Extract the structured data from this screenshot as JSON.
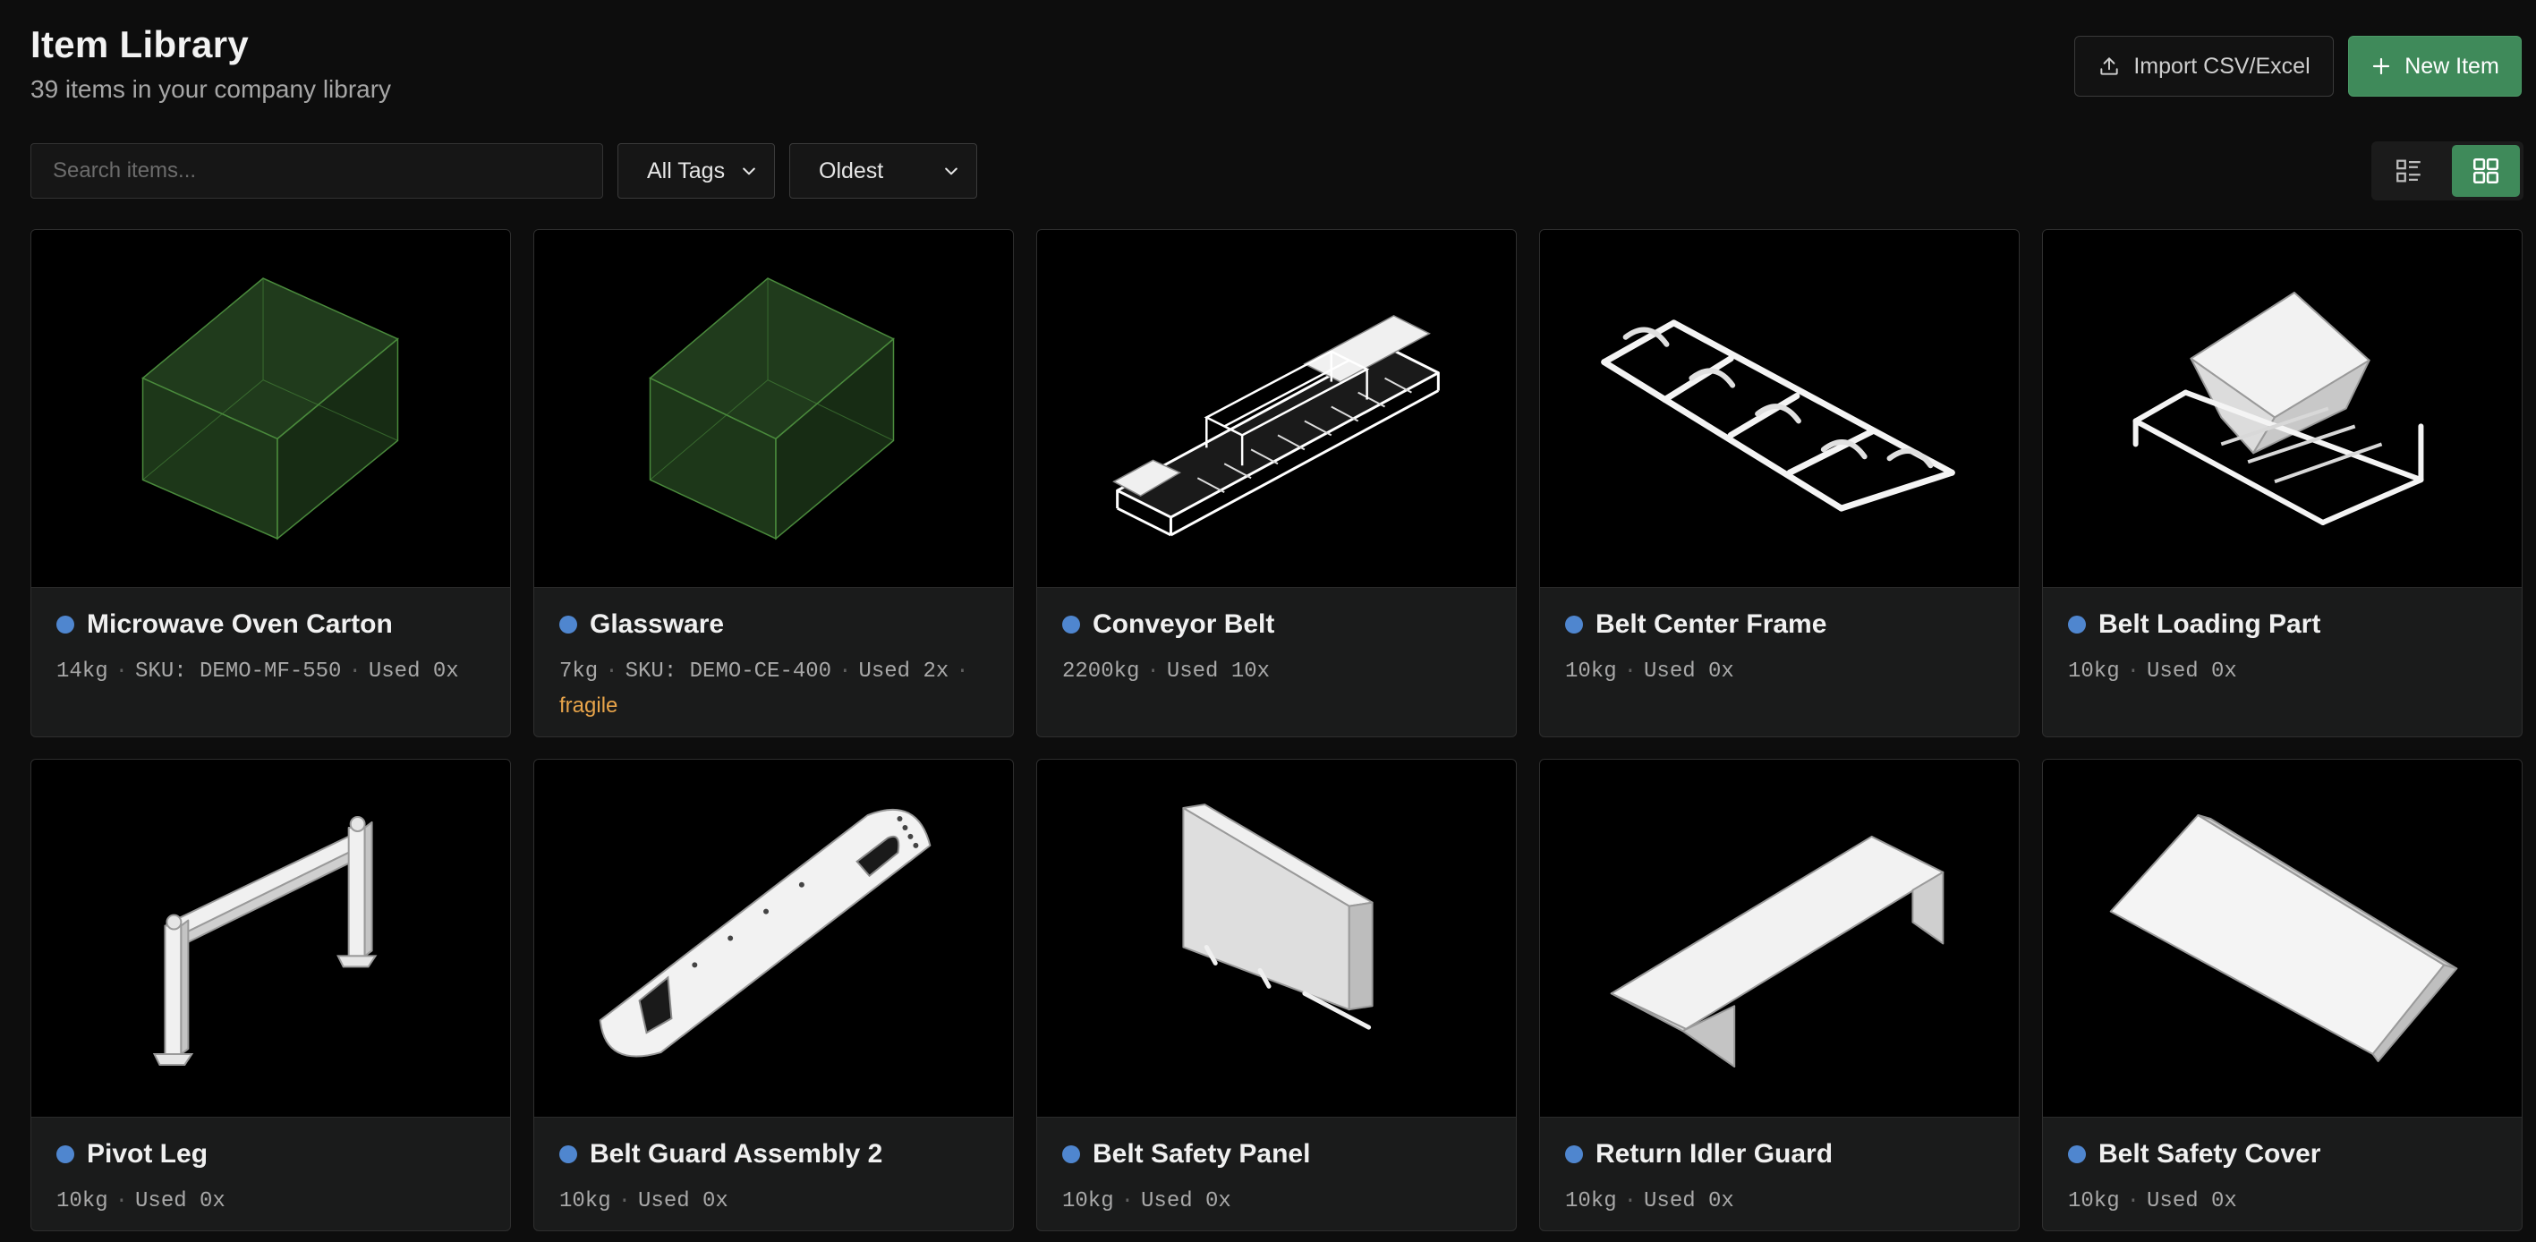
{
  "header": {
    "title": "Item Library",
    "subtitle": "39 items in your company library"
  },
  "actions": {
    "import_label": "Import CSV/Excel",
    "new_label": "New Item"
  },
  "filters": {
    "search_placeholder": "Search items...",
    "tags_value": "All Tags",
    "sort_value": "Oldest"
  },
  "colors": {
    "accent": "#3f8a5a",
    "status_dot": "#4f86cf",
    "tag_warning": "#e8a44a"
  },
  "items": [
    {
      "name": "Microwave Oven Carton",
      "weight": "14kg",
      "sku": "SKU: DEMO-MF-550",
      "used": "Used 0x",
      "tag": "",
      "icon": "box-placeholder-icon"
    },
    {
      "name": "Glassware",
      "weight": "7kg",
      "sku": "SKU: DEMO-CE-400",
      "used": "Used 2x",
      "tag": "fragile",
      "icon": "box-placeholder-icon"
    },
    {
      "name": "Conveyor Belt",
      "weight": "2200kg",
      "sku": "",
      "used": "Used 10x",
      "tag": "",
      "icon": "conveyor-model-icon"
    },
    {
      "name": "Belt Center Frame",
      "weight": "10kg",
      "sku": "",
      "used": "Used 0x",
      "tag": "",
      "icon": "frame-model-icon"
    },
    {
      "name": "Belt Loading Part",
      "weight": "10kg",
      "sku": "",
      "used": "Used 0x",
      "tag": "",
      "icon": "hopper-model-icon"
    },
    {
      "name": "Pivot Leg",
      "weight": "10kg",
      "sku": "",
      "used": "Used 0x",
      "tag": "",
      "icon": "leg-model-icon"
    },
    {
      "name": "Belt Guard Assembly 2",
      "weight": "10kg",
      "sku": "",
      "used": "Used 0x",
      "tag": "",
      "icon": "guard-model-icon"
    },
    {
      "name": "Belt Safety Panel",
      "weight": "10kg",
      "sku": "",
      "used": "Used 0x",
      "tag": "",
      "icon": "panel-model-icon"
    },
    {
      "name": "Return Idler Guard",
      "weight": "10kg",
      "sku": "",
      "used": "Used 0x",
      "tag": "",
      "icon": "idler-guard-model-icon"
    },
    {
      "name": "Belt Safety Cover",
      "weight": "10kg",
      "sku": "",
      "used": "Used 0x",
      "tag": "",
      "icon": "cover-model-icon"
    }
  ]
}
